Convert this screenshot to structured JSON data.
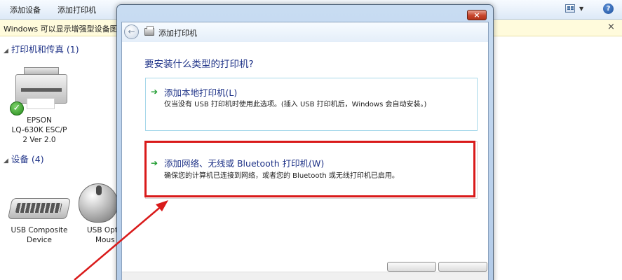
{
  "toolbar": {
    "add_device": "添加设备",
    "add_printer": "添加打印机"
  },
  "info_bar": {
    "text": "Windows 可以显示增强型设备图标",
    "close": "×"
  },
  "groups": {
    "printers": {
      "header": "打印机和传真 (1)"
    },
    "devices": {
      "header": "设备 (4)"
    }
  },
  "devices": {
    "printer": {
      "label_line1": "EPSON",
      "label_line2": "LQ-630K ESC/P",
      "label_line3": "2 Ver 2.0"
    },
    "keyboard": {
      "label_line1": "USB Composite",
      "label_line2": "Device"
    },
    "mouse": {
      "label_line1": "USB Opt",
      "label_line2": "Mous"
    }
  },
  "dialog": {
    "title": "添加打印机",
    "close": "×",
    "question": "要安装什么类型的打印机?",
    "options": [
      {
        "title": "添加本地打印机(L)",
        "description": "仅当没有 USB 打印机时使用此选项。(插入 USB 打印机后，Windows 会自动安装。)"
      },
      {
        "title": "添加网络、无线或 Bluetooth 打印机(W)",
        "description": "确保您的计算机已连接到网络，或者您的 Bluetooth 或无线打印机已启用。"
      }
    ]
  },
  "colors": {
    "highlight": "#d91a1a",
    "link_blue": "#1e3287",
    "arrow_green": "#1b9a2c",
    "info_bar_bg": "#fffbdc"
  }
}
